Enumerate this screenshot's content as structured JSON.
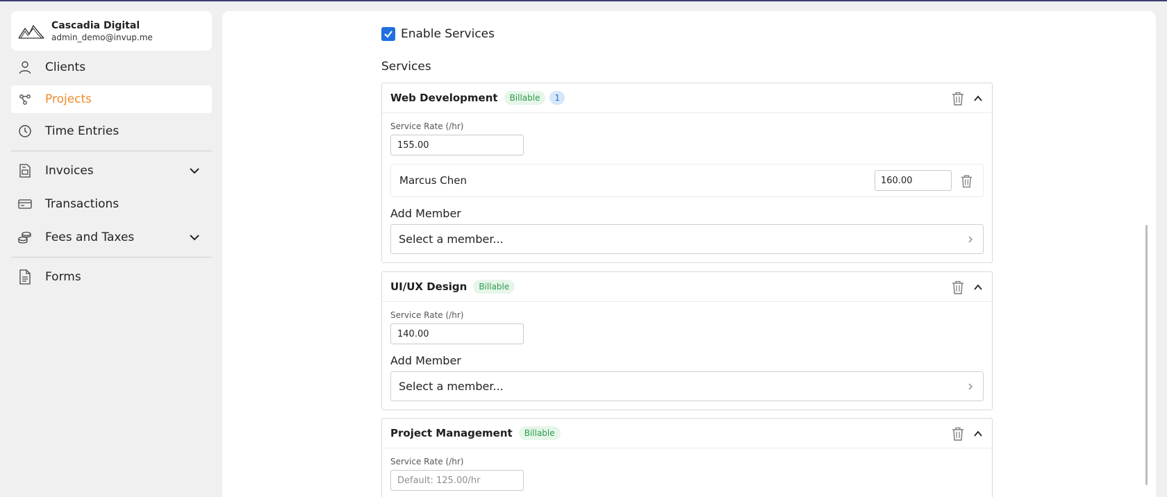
{
  "org": {
    "name": "Cascadia Digital",
    "email": "admin_demo@invup.me"
  },
  "nav": {
    "clients": "Clients",
    "projects": "Projects",
    "time_entries": "Time Entries",
    "invoices": "Invoices",
    "transactions": "Transactions",
    "fees_taxes": "Fees and Taxes",
    "forms": "Forms",
    "active": "Projects"
  },
  "colors": {
    "accent": "#ee8a2b",
    "checkbox": "#1f6fe0",
    "billable_text": "#2e9a4b",
    "billable_bg": "#e6f6ea"
  },
  "enable_services": {
    "label": "Enable Services",
    "checked": true
  },
  "services_title": "Services",
  "services": [
    {
      "name": "Web Development",
      "badge": "Billable",
      "count": "1",
      "rate_label": "Service Rate (/hr)",
      "rate_value": "155.00",
      "members": [
        {
          "name": "Marcus Chen",
          "rate": "160.00"
        }
      ],
      "add_member_label": "Add Member",
      "add_member_placeholder": "Select a member..."
    },
    {
      "name": "UI/UX Design",
      "badge": "Billable",
      "rate_label": "Service Rate (/hr)",
      "rate_value": "140.00",
      "add_member_label": "Add Member",
      "add_member_placeholder": "Select a member..."
    },
    {
      "name": "Project Management",
      "badge": "Billable",
      "rate_label": "Service Rate (/hr)",
      "rate_value": "",
      "rate_placeholder": "Default: 125.00/hr"
    }
  ]
}
